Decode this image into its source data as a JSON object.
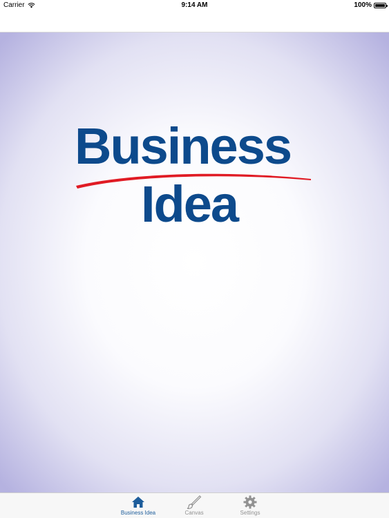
{
  "status_bar": {
    "carrier": "Carrier",
    "time": "9:14 AM",
    "battery_percent": "100%",
    "battery_level": 1.0,
    "icons": [
      "wifi-icon",
      "battery-icon"
    ]
  },
  "logo": {
    "line1": "Business",
    "line2": "Idea",
    "brand_color": "#0d4a8c",
    "swoosh_color": "#e01b24"
  },
  "tab_bar": {
    "active_color": "#1d5d9b",
    "inactive_color": "#929292",
    "tabs": [
      {
        "label": "Business Idea",
        "icon": "home-icon",
        "active": true
      },
      {
        "label": "Canvas",
        "icon": "brush-icon",
        "active": false
      },
      {
        "label": "Settings",
        "icon": "gear-icon",
        "active": false
      }
    ]
  }
}
